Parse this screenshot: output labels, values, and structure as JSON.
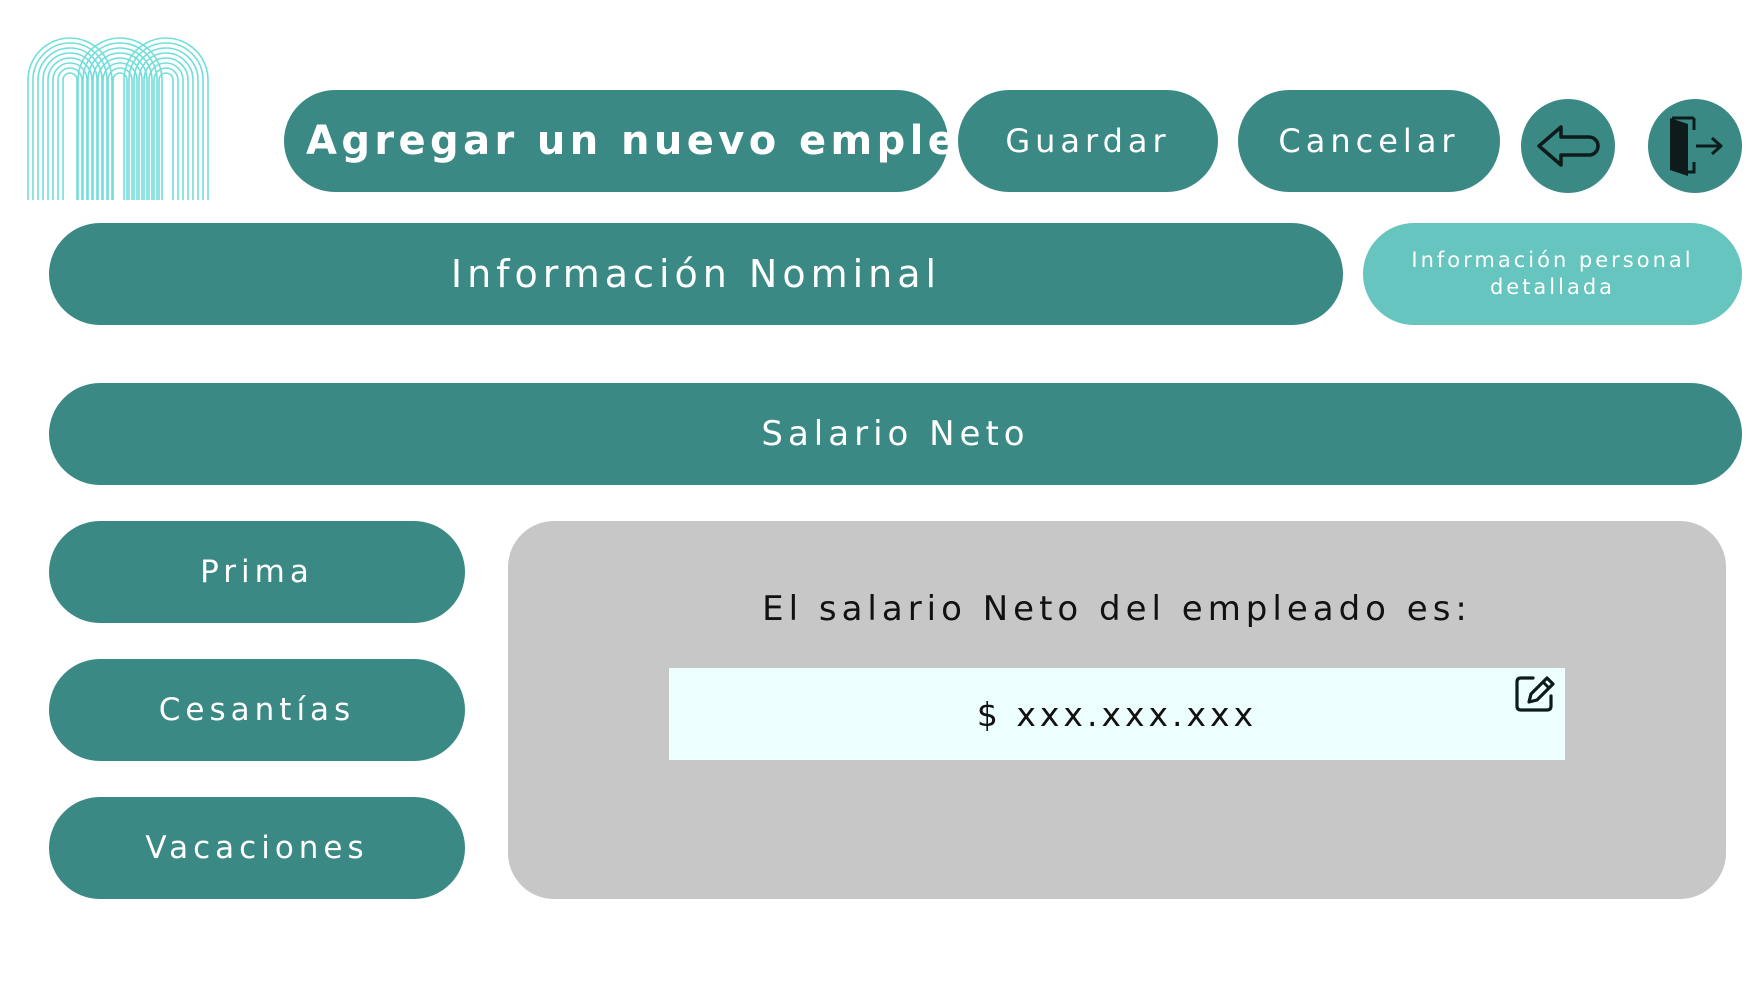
{
  "colors": {
    "teal": "#3a8984",
    "teal_light": "#67c5bf",
    "logo_cyan": "#63dbd8",
    "panel_gray": "#c7c7c7",
    "field_bg": "#ecfefd"
  },
  "logo": {
    "icon": "logo-arches-icon"
  },
  "header": {
    "title": "Agregar un nuevo empleado",
    "save_label": "Guardar",
    "cancel_label": "Cancelar",
    "back_icon": "arrow-left-icon",
    "exit_icon": "exit-door-icon"
  },
  "tabs": {
    "nominal": "Información Nominal",
    "personal_line1": "Información personal",
    "personal_line2": "detallada"
  },
  "section_title": "Salario Neto",
  "side_menu": [
    {
      "label": "Prima"
    },
    {
      "label": "Cesantías"
    },
    {
      "label": "Vacaciones"
    }
  ],
  "result": {
    "label": "El salario Neto del empleado es:",
    "value": "$ xxx.xxx.xxx",
    "edit_icon": "edit-icon"
  }
}
